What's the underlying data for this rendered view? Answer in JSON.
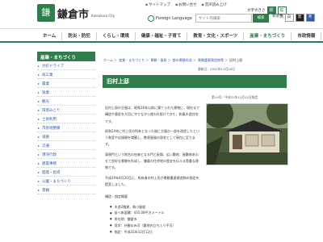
{
  "header": {
    "logo_mark": "鎌",
    "city_name": "鎌倉市",
    "city_name_en": "Kamakura City",
    "util_links": [
      "サイトマップ",
      "お問い合せ",
      "音声読み上げ"
    ],
    "font_size_label": "文字大きさ",
    "font_sizes": [
      "標準",
      "拡大"
    ],
    "language_label": "Foreign Language",
    "search_placeholder": "サイト内検索",
    "search_button": "検索",
    "bg_color_label": "背景色",
    "bg_colors": [
      "白",
      "黒",
      "青"
    ]
  },
  "globalnav": {
    "items": [
      "ホーム",
      "防災・防犯",
      "くらし・環境",
      "健康・福祉・子育て",
      "教育・文化・スポーツ",
      "産業・まちづくり",
      "市政情報"
    ],
    "active_index": 5
  },
  "sidebar": {
    "title": "産業・まちづくり",
    "items": [
      "大町ドライブ",
      "商工業",
      "農業",
      "漁業",
      "観光",
      "環境みどり",
      "土地利用",
      "市街地整備",
      "道路",
      "交通",
      "港湾行政",
      "建築事務",
      "開発・指導",
      "公園・まちづくり",
      "景観"
    ]
  },
  "breadcrumb": {
    "items": [
      "ホーム",
      "産業・まちづくり",
      "景観・風致",
      "都市景観形成",
      "景観重要建造物等"
    ],
    "current": "旧村上邸"
  },
  "page": {
    "title": "旧村上邸",
    "updated": "更新日：2021年11月29日",
    "designation": "第10号／平成31年12月12日指定",
    "paragraphs": [
      "旧村上邸の主屋は、昭和16年以前に建てられた建物に、現在まで構造や意匠を大切に守りながら使われ続けてきた、和風木造住宅です。",
      "昭和24年に村上氏の所有となった後に主屋の一部を改造したという和室や応接間を増築し、数寄屋風の邸宅として現在に至ります。",
      "東側門という地名の由来となる門と板塀、広い敷地、屋敷林あわせて良好な景観を形成し、鎌倉の住宅地の歴史を伝える貴重な建物です。",
      "平成29年4月20日に、所有者の村上氏が景観重要建造物の指定を提案しました。"
    ],
    "details_heading": "構造・指定概要",
    "details": [
      "木造2階建、和小屋組",
      "延べ床面積：435.08平方メートル",
      "所在地：鎌倉市",
      "見学：外観のみ可（敷地内立ち入り不可）",
      "指定：平成31年12月12日"
    ]
  },
  "colors": {
    "brand_green": "#2e7d4a",
    "link_blue": "#2a5db0"
  }
}
